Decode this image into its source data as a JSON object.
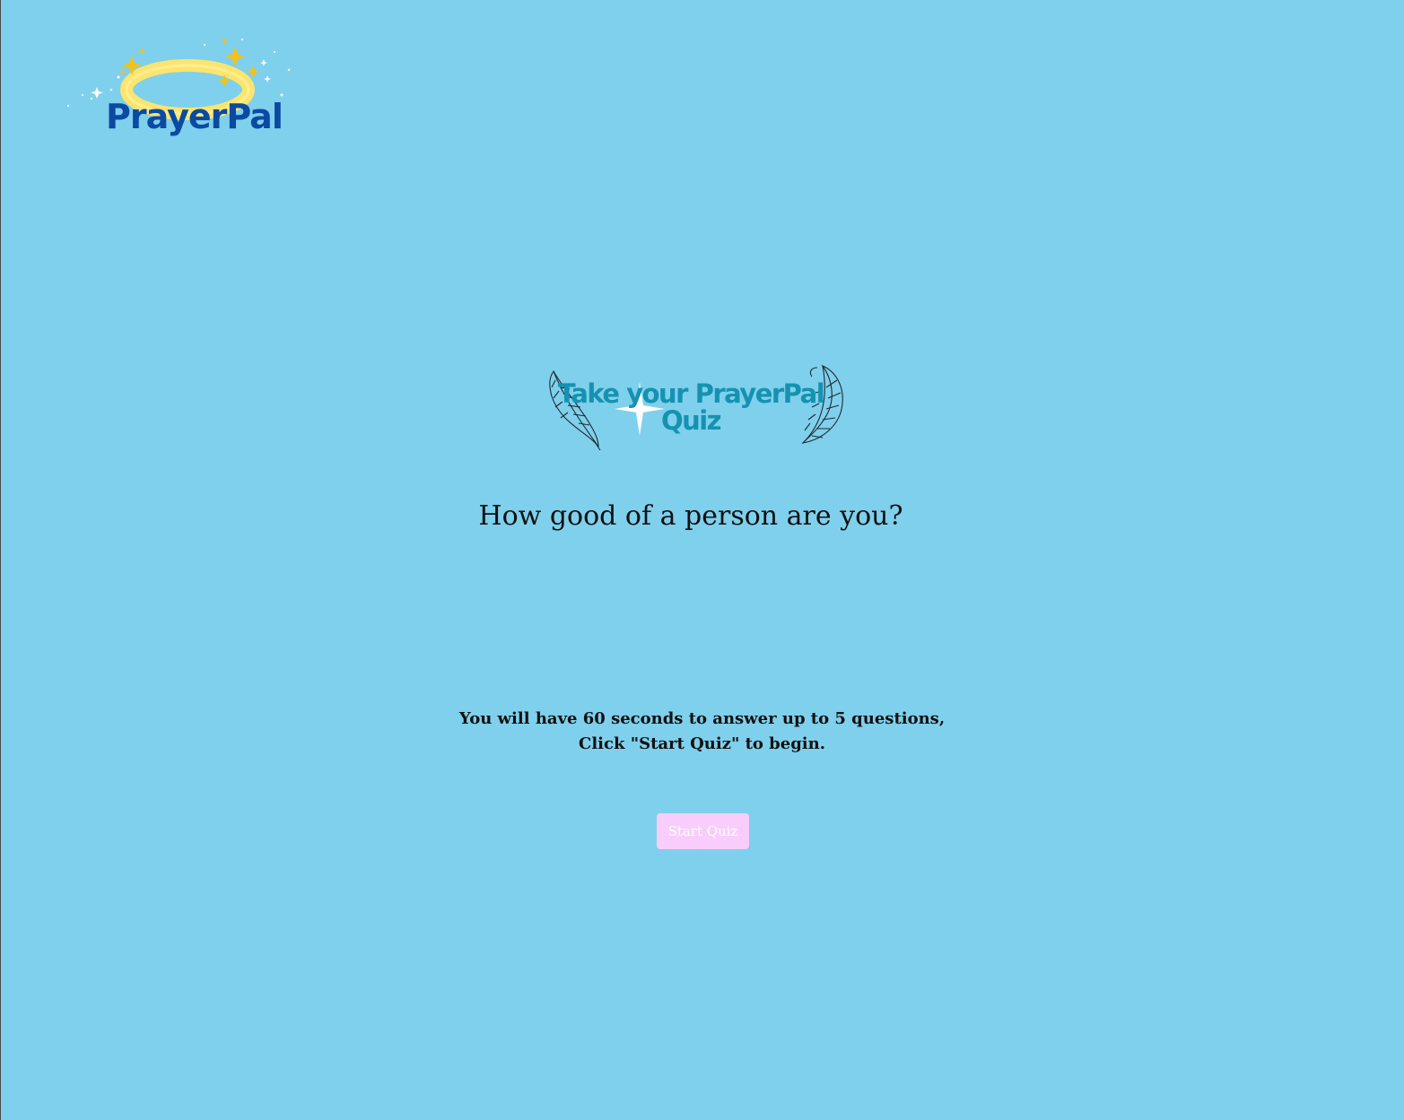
{
  "logo": {
    "text": "PrayerPal"
  },
  "banner": {
    "line1": "Take your PrayerPal",
    "line2": "Quiz"
  },
  "subtitle": "How good of a person are you?",
  "instructions": {
    "line1": "You will have 60 seconds to answer up to 5 questions,",
    "line2": "Click \"Start Quiz\" to begin."
  },
  "start_button": {
    "label": "Start Quiz"
  },
  "colors": {
    "background": "#7fd0ec",
    "logo_text": "#0b4aa3",
    "halo": "#fce56e",
    "sparkle": "#f2c21b",
    "banner_text": "#1592b1",
    "button_bg": "#f9cdfb",
    "button_text": "#ffffff"
  },
  "icons": [
    "halo-icon",
    "sparkle-icon",
    "feather-icon"
  ]
}
